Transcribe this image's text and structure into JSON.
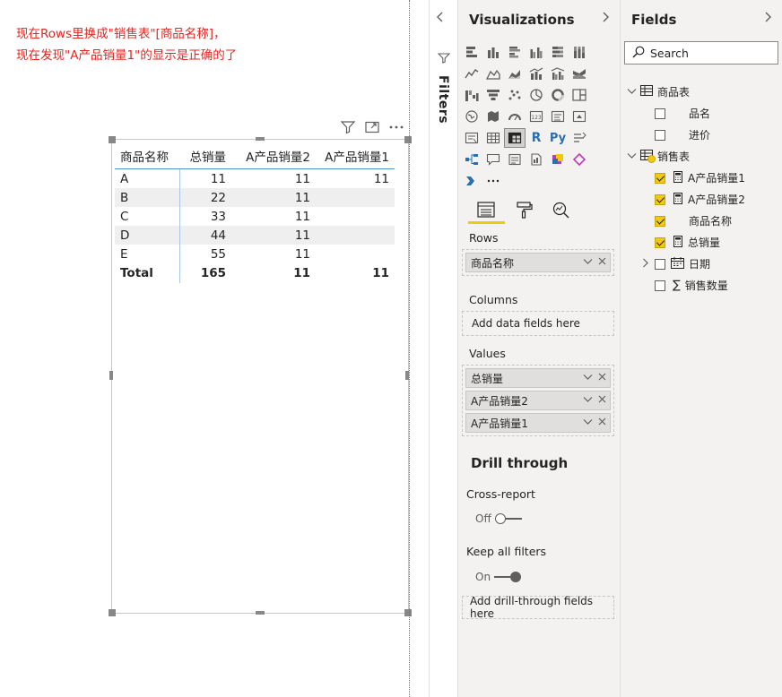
{
  "annotation": {
    "line1": "现在Rows里换成\"销售表\"[商品名称]，",
    "line2": "现在发现\"A产品销量1\"的显示是正确的了"
  },
  "matrix": {
    "headers": [
      "商品名称",
      "总销量",
      "A产品销量2",
      "A产品销量1"
    ],
    "rows": [
      [
        "A",
        "11",
        "11",
        "11"
      ],
      [
        "B",
        "22",
        "11",
        ""
      ],
      [
        "C",
        "33",
        "11",
        ""
      ],
      [
        "D",
        "44",
        "11",
        ""
      ],
      [
        "E",
        "55",
        "11",
        ""
      ]
    ],
    "total": [
      "Total",
      "165",
      "11",
      "11"
    ]
  },
  "filters_pane": {
    "label": "Filters"
  },
  "visualizations": {
    "title": "Visualizations",
    "rows_label": "Rows",
    "rows_fields": [
      "商品名称"
    ],
    "columns_label": "Columns",
    "columns_placeholder": "Add data fields here",
    "values_label": "Values",
    "values_fields": [
      "总销量",
      "A产品销量2",
      "A产品销量1"
    ],
    "drill_title": "Drill through",
    "cross_report_label": "Cross-report",
    "cross_report_state": "Off",
    "keep_filters_label": "Keep all filters",
    "keep_filters_state": "On",
    "drill_placeholder": "Add drill-through fields here",
    "custom_icons": {
      "r": "R",
      "py": "Py",
      "card_number": "123"
    }
  },
  "fields": {
    "title": "Fields",
    "search_placeholder": "Search",
    "tables": [
      {
        "name": "商品表",
        "items": [
          {
            "name": "品名",
            "checked": false
          },
          {
            "name": "进价",
            "checked": false
          }
        ]
      },
      {
        "name": "销售表",
        "items": [
          {
            "name": "A产品销量1",
            "checked": true,
            "icon": "measure-icon"
          },
          {
            "name": "A产品销量2",
            "checked": true,
            "icon": "measure-icon"
          },
          {
            "name": "商品名称",
            "checked": true
          },
          {
            "name": "总销量",
            "checked": true,
            "icon": "measure-icon"
          },
          {
            "name": "日期",
            "checked": false,
            "icon": "calendar-icon"
          },
          {
            "name": "销售数量",
            "checked": false,
            "icon": "sigma-icon"
          }
        ]
      }
    ]
  },
  "colors": {
    "annotation": "#e8241f",
    "accent_yellow": "#f2c811",
    "matrix_header_line": "#4a90c8"
  }
}
